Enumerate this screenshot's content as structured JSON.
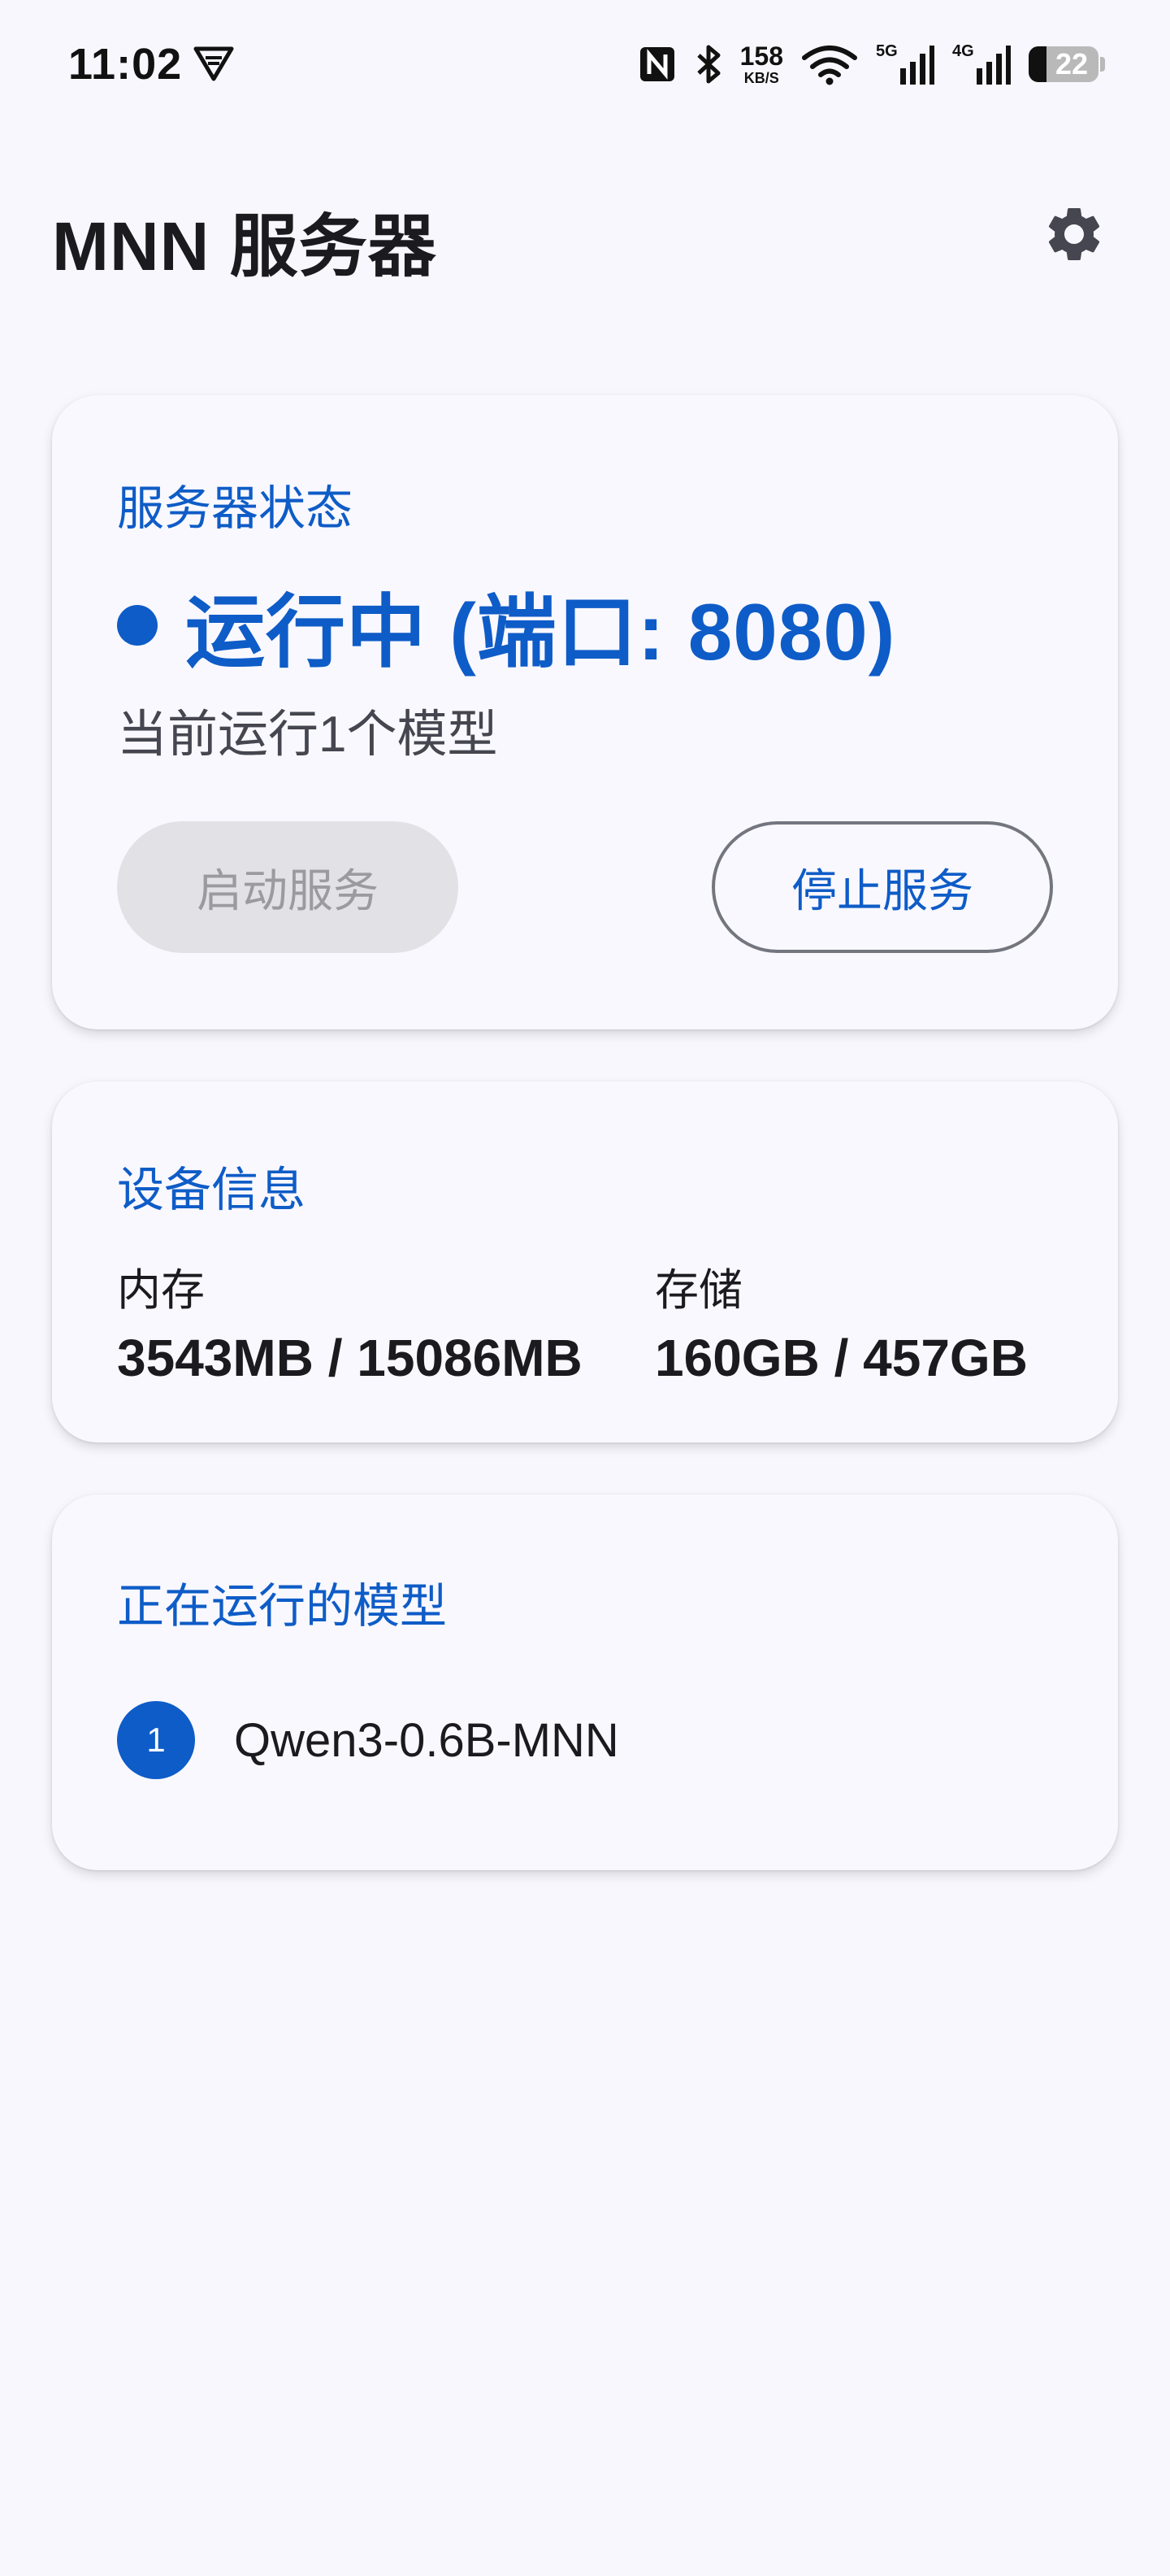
{
  "status_bar": {
    "time": "11:02",
    "net_speed": "158",
    "net_speed_unit": "KB/S",
    "sim1_gen": "5G",
    "sim2_gen": "4G",
    "battery": "22",
    "icons": [
      "vpn-icon",
      "nfc-icon",
      "bluetooth-icon",
      "wifi-icon",
      "signal-icon",
      "battery-icon"
    ]
  },
  "header": {
    "title": "MNN 服务器",
    "settings_icon": "gear-icon"
  },
  "server_status": {
    "title": "服务器状态",
    "status_text": "运行中 (端口: 8080)",
    "running_models": "当前运行1个模型",
    "start_button": "启动服务",
    "stop_button": "停止服务"
  },
  "device_info": {
    "title": "设备信息",
    "memory_label": "内存",
    "memory_value": "3543MB / 15086MB",
    "storage_label": "存储",
    "storage_value": "160GB / 457GB"
  },
  "running_models": {
    "title": "正在运行的模型",
    "items": [
      {
        "index": "1",
        "name": "Qwen3-0.6B-MNN"
      }
    ]
  },
  "colors": {
    "accent": "#0e5cc7",
    "background": "#f8f7fd",
    "disabled_button": "#e2e2e6"
  }
}
